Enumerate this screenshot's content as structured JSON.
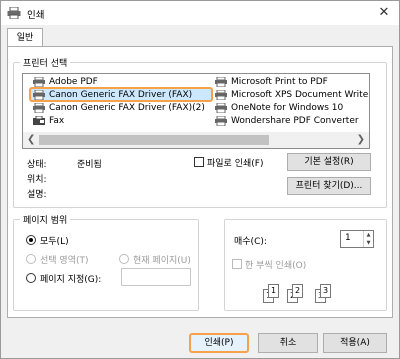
{
  "window": {
    "title": "인쇄",
    "close_glyph": "✕"
  },
  "tabs": [
    {
      "label": "일반"
    }
  ],
  "printer_select": {
    "title": "프린터 선택",
    "printers": [
      {
        "label": "Adobe PDF",
        "icon": "printer-icon"
      },
      {
        "label": "Canon Generic FAX Driver (FAX)",
        "icon": "printer-icon",
        "selected": true
      },
      {
        "label": "Canon Generic FAX Driver (FAX)(2)",
        "icon": "printer-icon"
      },
      {
        "label": "Fax",
        "icon": "fax-icon"
      },
      {
        "label": "Microsoft Print to PDF",
        "icon": "printer-icon"
      },
      {
        "label": "Microsoft XPS Document Writer",
        "icon": "printer-icon"
      },
      {
        "label": "OneNote for Windows 10",
        "icon": "printer-icon"
      },
      {
        "label": "Wondershare PDF Converter",
        "icon": "printer-icon"
      }
    ],
    "status_label": "상태:",
    "status_value": "준비됨",
    "location_label": "위치:",
    "comment_label": "설명:",
    "print_to_file_label": "파일로 인쇄(F)",
    "preferences_button": "기본 설정(R)",
    "find_printer_button": "프린터 찾기(D)..."
  },
  "page_range": {
    "title": "페이지 범위",
    "all_label": "모두(L)",
    "selection_label": "선택 영역(T)",
    "current_page_label": "현재 페이지(U)",
    "pages_label": "페이지 지정(G):"
  },
  "copies": {
    "label": "매수(C):",
    "value": "1",
    "collate_label": "한 부씩 인쇄(O)",
    "collate_pages": [
      "1",
      "1",
      "2",
      "2",
      "3",
      "3"
    ]
  },
  "buttons": {
    "print": "인쇄(P)",
    "cancel": "취소",
    "apply": "적용(A)"
  },
  "colors": {
    "accent": "#f7a14a",
    "selection": "#cce8ff"
  }
}
